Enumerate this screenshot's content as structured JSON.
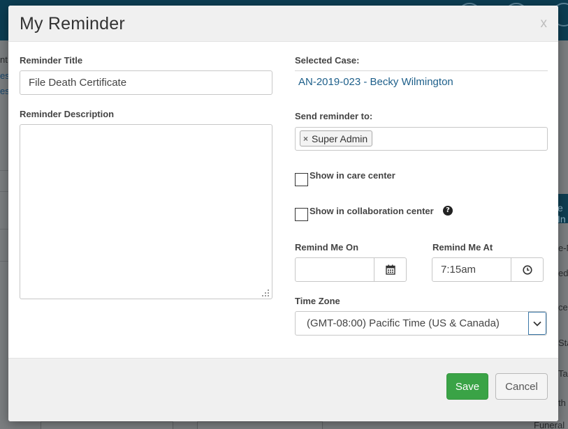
{
  "modal": {
    "title": "My Reminder",
    "close_label": "x"
  },
  "form": {
    "reminder_title_label": "Reminder Title",
    "reminder_title_value": "File Death Certificate",
    "reminder_description_label": "Reminder Description",
    "reminder_description_value": "",
    "selected_case_label": "Selected Case:",
    "selected_case_value": "AN-2019-023 - Becky Wilmington",
    "send_to_label": "Send reminder to:",
    "send_to_tags": [
      {
        "label": "Super Admin",
        "remove": "×"
      }
    ],
    "show_care_center_label": "Show in care center",
    "show_care_center_checked": false,
    "show_collab_center_label": "Show in collaboration center",
    "show_collab_center_checked": false,
    "help_icon_glyph": "?",
    "remind_on_label": "Remind Me On",
    "remind_on_value": "",
    "remind_at_label": "Remind Me At",
    "remind_at_value": "7:15am",
    "time_zone_label": "Time Zone",
    "time_zone_value": "(GMT-08:00) Pacific Time (US & Canada)"
  },
  "footer": {
    "save_label": "Save",
    "cancel_label": "Cancel"
  },
  "icons": {
    "calendar": "calendar-icon",
    "clock": "clock-icon",
    "chevron": "chevron-down-icon",
    "help": "question-circle-icon",
    "resize": "resize-grip-icon"
  },
  "colors": {
    "header_bar": "#0c3d52",
    "save_button": "#3aa346",
    "case_link": "#1d5f8a",
    "select_focus": "#3b78a8"
  },
  "background": {
    "fragments": [
      "nt",
      "es",
      "es",
      "e In",
      "e-N",
      "ed",
      "ce",
      "Sta",
      "Ta",
      "th",
      "Funeral"
    ]
  }
}
